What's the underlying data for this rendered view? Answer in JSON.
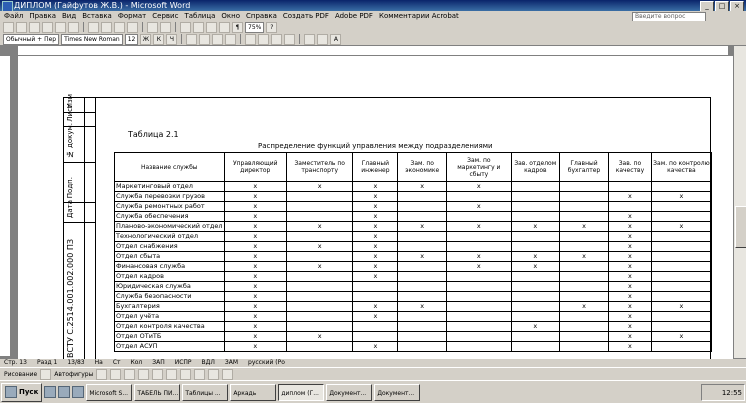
{
  "window": {
    "title": "ДИПЛОМ (Гайфутов Ж.В.) - Microsoft Word"
  },
  "menu": {
    "items": [
      "Файл",
      "Правка",
      "Вид",
      "Вставка",
      "Формат",
      "Сервис",
      "Таблица",
      "Окно",
      "Справка",
      "Создать PDF",
      "Adobe PDF",
      "Комментарии Acrobat"
    ],
    "help_placeholder": "Введите вопрос"
  },
  "toolbar": {
    "style": "Обычный + Пер",
    "font": "Times New Roman",
    "size": "12",
    "zoom": "75%"
  },
  "document": {
    "stamp_labels": [
      "Изм",
      "Лист",
      "№ докум.",
      "Подп.",
      "Дата"
    ],
    "doc_code": "ВСТУ С.2514.001.002.000 ПЗ",
    "table_number": "Таблица 2.1",
    "table_title": "Распределение функций управления между подразделениями",
    "columns": [
      "Название службы",
      "Управляющий директор",
      "Заместитель по транспорту",
      "Главный инженер",
      "Зам. по экономике",
      "Зам. по маркетингу и сбыту",
      "Зав. отделом кадров",
      "Главный бухгалтер",
      "Зав. по качеству",
      "Зам. по контролю качества"
    ],
    "rows": [
      {
        "name": "Маркетинговый отдел",
        "marks": [
          "x",
          "x",
          "x",
          "x",
          "x",
          "",
          "",
          "",
          ""
        ]
      },
      {
        "name": "Служба перевозки грузов",
        "marks": [
          "x",
          "",
          "x",
          "",
          "",
          "",
          "",
          "x",
          "x"
        ]
      },
      {
        "name": "Служба ремонтных работ",
        "marks": [
          "x",
          "",
          "x",
          "",
          "x",
          "",
          "",
          "",
          ""
        ]
      },
      {
        "name": "Служба обеспечения",
        "marks": [
          "x",
          "",
          "x",
          "",
          "",
          "",
          "",
          "x",
          ""
        ]
      },
      {
        "name": "Планово-экономический отдел",
        "marks": [
          "x",
          "x",
          "x",
          "x",
          "x",
          "x",
          "x",
          "x",
          "x"
        ]
      },
      {
        "name": "Технологический отдел",
        "marks": [
          "x",
          "",
          "x",
          "",
          "",
          "",
          "",
          "x",
          ""
        ]
      },
      {
        "name": "Отдел снабжения",
        "marks": [
          "x",
          "x",
          "x",
          "",
          "",
          "",
          "",
          "x",
          ""
        ]
      },
      {
        "name": "Отдел сбыта",
        "marks": [
          "x",
          "",
          "x",
          "x",
          "x",
          "x",
          "x",
          "x",
          ""
        ]
      },
      {
        "name": "Финансовая служба",
        "marks": [
          "x",
          "x",
          "x",
          "",
          "x",
          "x",
          "",
          "x",
          ""
        ]
      },
      {
        "name": "Отдел кадров",
        "marks": [
          "x",
          "",
          "x",
          "",
          "",
          "",
          "",
          "x",
          ""
        ]
      },
      {
        "name": "Юридическая служба",
        "marks": [
          "x",
          "",
          "",
          "",
          "",
          "",
          "",
          "x",
          ""
        ]
      },
      {
        "name": "Служба безопасности",
        "marks": [
          "x",
          "",
          "",
          "",
          "",
          "",
          "",
          "x",
          ""
        ]
      },
      {
        "name": "Бухгалтерия",
        "marks": [
          "x",
          "",
          "x",
          "x",
          "",
          "",
          "x",
          "x",
          "x"
        ]
      },
      {
        "name": "Отдел учёта",
        "marks": [
          "x",
          "",
          "x",
          "",
          "",
          "",
          "",
          "x",
          ""
        ]
      },
      {
        "name": "Отдел контроля качества",
        "marks": [
          "x",
          "",
          "",
          "",
          "",
          "x",
          "",
          "x",
          ""
        ]
      },
      {
        "name": "Отдел ОТиТБ",
        "marks": [
          "x",
          "x",
          "",
          "",
          "",
          "",
          "",
          "x",
          "x"
        ]
      },
      {
        "name": "Отдел АСУП",
        "marks": [
          "x",
          "",
          "x",
          "",
          "",
          "",
          "",
          "x",
          ""
        ]
      }
    ]
  },
  "status": {
    "page": "Стр. 13",
    "section": "Разд 1",
    "pages": "13/83",
    "position": "На",
    "line": "Ст",
    "col": "Кол",
    "flags": [
      "ЗАП",
      "ИСПР",
      "ВДЛ",
      "ЗАМ",
      "русский (Ро"
    ]
  },
  "drawbar": {
    "draw_label": "Рисование",
    "autoshapes_label": "Автофигуры"
  },
  "taskbar": {
    "start_label": "Пуск",
    "tasks": [
      "Microsoft S...",
      "ТАБЕЛЬ ПИ...",
      "Таблицы ...",
      "Аркадь",
      "диплом (Г...",
      "Документ...",
      "Документ..."
    ],
    "clock": "12:55"
  }
}
